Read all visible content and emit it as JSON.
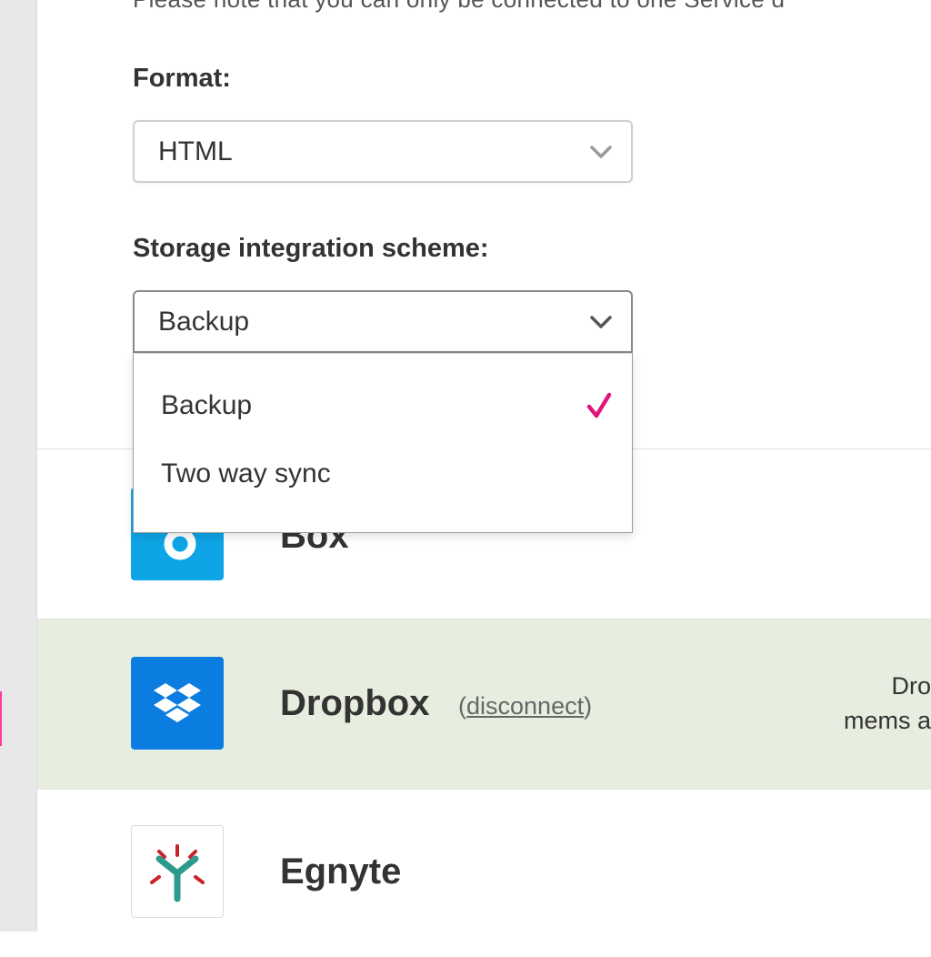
{
  "note_text": "Please note that you can only be connected to one Service d",
  "format": {
    "label": "Format:",
    "selected": "HTML"
  },
  "scheme": {
    "label": "Storage integration scheme:",
    "selected": "Backup",
    "options": [
      {
        "label": "Backup",
        "selected": true
      },
      {
        "label": "Two way sync",
        "selected": false
      }
    ]
  },
  "services": [
    {
      "name": "Box",
      "icon": "box-logo",
      "color": "#0ea5e6"
    },
    {
      "name": "Dropbox",
      "icon": "dropbox-logo",
      "color": "#0b7de0",
      "disconnect_open": "(",
      "disconnect_label": "disconnect",
      "disconnect_close": ")",
      "description_line1": "Dro",
      "description_line2": "mems a"
    },
    {
      "name": "Egnyte",
      "icon": "egnyte-logo"
    }
  ],
  "colors": {
    "accent_check": "#e0147c",
    "connected_row": "#e8eedf"
  }
}
